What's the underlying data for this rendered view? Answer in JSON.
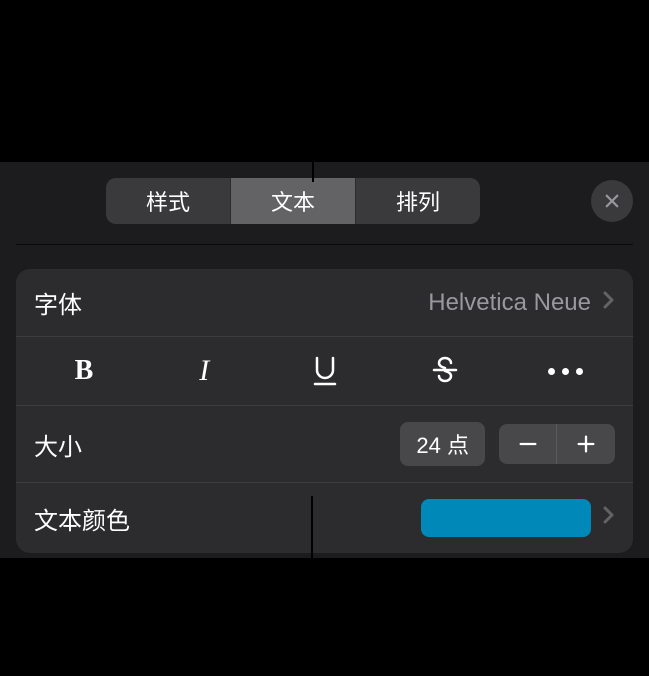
{
  "tabs": {
    "style": "样式",
    "text": "文本",
    "arrange": "排列"
  },
  "font": {
    "label": "字体",
    "value": "Helvetica Neue"
  },
  "size": {
    "label": "大小",
    "value": "24 点"
  },
  "textColor": {
    "label": "文本颜色",
    "value": "#0089b8"
  }
}
